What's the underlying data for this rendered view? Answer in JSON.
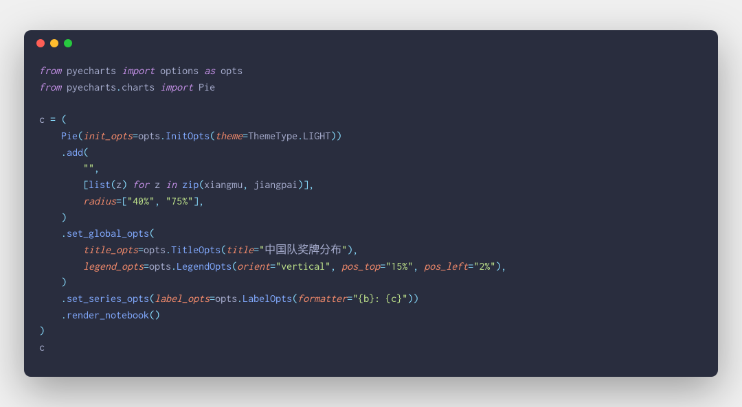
{
  "line1": {
    "kw_from": "from",
    "mod1": "pyecharts",
    "kw_import": "import",
    "mod2": "options",
    "kw_as": "as",
    "alias": "opts"
  },
  "line2": {
    "kw_from": "from",
    "mod1": "pyecharts",
    "dot": ".",
    "mod2": "charts",
    "kw_import": "import",
    "cls": "Pie"
  },
  "line4": {
    "var": "c",
    "eq": " = ",
    "lp": "("
  },
  "line5": {
    "cls": "Pie",
    "lp": "(",
    "kw": "init_opts",
    "eq": "=",
    "ns": "opts",
    "dot": ".",
    "fn": "InitOpts",
    "lp2": "(",
    "kw2": "theme",
    "eq2": "=",
    "obj": "ThemeType",
    "dot2": ".",
    "prop": "LIGHT",
    "rp": "))"
  },
  "line6": {
    "dot": ".",
    "fn": "add",
    "lp": "("
  },
  "line7": {
    "q1": "\"\"",
    "comma": ","
  },
  "line8": {
    "lbr": "[",
    "fn": "list",
    "lp": "(",
    "z": "z",
    "rp": ")",
    "for": "for",
    "z2": "z",
    "in": "in",
    "zip": "zip",
    "lp2": "(",
    "a": "xiangmu",
    "c1": ", ",
    "b": "jiangpai",
    "rp2": ")]",
    "comma": ","
  },
  "line9": {
    "kw": "radius",
    "eq": "=[",
    "s1": "\"40%\"",
    "c": ", ",
    "s2": "\"75%\"",
    "rb": "],"
  },
  "line10": {
    "rp": ")"
  },
  "line11": {
    "dot": ".",
    "fn": "set_global_opts",
    "lp": "("
  },
  "line12": {
    "kw": "title_opts",
    "eq": "=",
    "ns": "opts",
    "dot": ".",
    "fn": "TitleOpts",
    "lp": "(",
    "kw2": "title",
    "eq2": "=",
    "q": "\"",
    "txt": "中国队奖牌分布",
    "q2": "\"",
    "rp": "),"
  },
  "line13": {
    "kw": "legend_opts",
    "eq": "=",
    "ns": "opts",
    "dot": ".",
    "fn": "LegendOpts",
    "lp": "(",
    "k1": "orient",
    "e1": "=",
    "v1": "\"vertical\"",
    "c1": ", ",
    "k2": "pos_top",
    "e2": "=",
    "v2": "\"15%\"",
    "c2": ", ",
    "k3": "pos_left",
    "e3": "=",
    "v3": "\"2%\"",
    "rp": "),"
  },
  "line14": {
    "rp": ")"
  },
  "line15": {
    "dot": ".",
    "fn": "set_series_opts",
    "lp": "(",
    "kw": "label_opts",
    "eq": "=",
    "ns": "opts",
    "dot2": ".",
    "fn2": "LabelOpts",
    "lp2": "(",
    "kw2": "formatter",
    "eq2": "=",
    "v": "\"{b}: {c}\"",
    "rp": "))"
  },
  "line16": {
    "dot": ".",
    "fn": "render_notebook",
    "lp": "()"
  },
  "line17": {
    "rp": ")"
  },
  "line18": {
    "var": "c"
  }
}
